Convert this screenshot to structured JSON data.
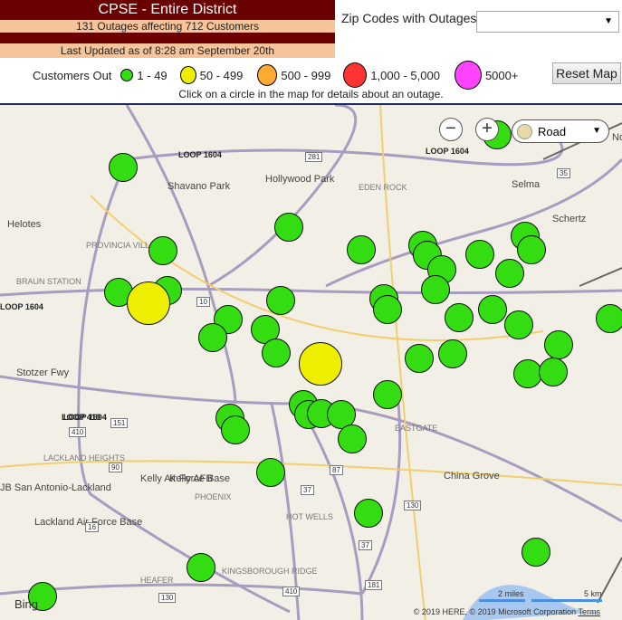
{
  "header": {
    "title": "CPSE - Entire District",
    "summary": "131 Outages affecting 712 Customers",
    "updated": "Last Updated as of 8:28 am September 20th"
  },
  "zip": {
    "label": "Zip Codes with Outages",
    "value": "",
    "arrow": "▼"
  },
  "legend": {
    "title": "Customers Out",
    "items": [
      {
        "label": "1 - 49",
        "color": "#33dd11"
      },
      {
        "label": "50 - 499",
        "color": "#eeee00"
      },
      {
        "label": "500 - 999",
        "color": "#ffaa33"
      },
      {
        "label": "1,000 - 5,000",
        "color": "#ff3333"
      },
      {
        "label": "5000+",
        "color": "#ff44ff"
      }
    ]
  },
  "reset_label": "Reset Map",
  "hint": "Click on a circle in the map for details about an outage.",
  "map": {
    "zoom_out": "−",
    "zoom_in": "+",
    "style": "Road",
    "style_arrow": "▼",
    "labels": [
      "Shavano Park",
      "Hollywood Park",
      "EDEN ROCK",
      "Selma",
      "Schertz",
      "Helotes",
      "PROVINCIA VILLAS",
      "BRAUN STATION",
      "Stotzer Fwy",
      "LACKLAND HEIGHTS",
      "JB San Antonio-Lackland",
      "Lackland Air Force Base",
      "Kelly Air Force Base",
      "Kelly AFB",
      "PHOENIX",
      "HOT WELLS",
      "HEAFER",
      "KINGSBOROUGH RIDGE",
      "EASTGATE",
      "China Grove",
      "No"
    ],
    "loops": [
      "LOOP 1604",
      "LOOP 1604",
      "LOOP 1604",
      "LOOP 1604",
      "LOOP 410"
    ],
    "shields": [
      "281",
      "35",
      "10",
      "151",
      "90",
      "87",
      "37",
      "90",
      "130",
      "16",
      "37",
      "410",
      "181",
      "410",
      "130"
    ],
    "scale_miles": "2 miles",
    "scale_km": "5 km",
    "copyright": "© 2019 HERE, © 2019 Microsoft Corporation",
    "terms": "Terms",
    "bing": "Bing"
  }
}
